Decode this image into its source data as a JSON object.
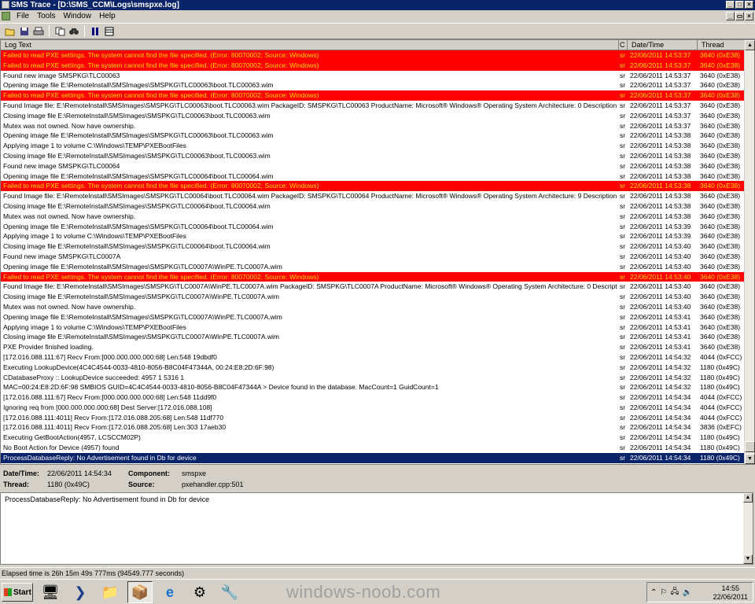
{
  "window": {
    "title": "SMS Trace - [D:\\SMS_CCM\\Logs\\smspxe.log]",
    "min": "_",
    "max": "□",
    "close": "×"
  },
  "menu": [
    "File",
    "Tools",
    "Window",
    "Help"
  ],
  "mdi": {
    "min": "_",
    "restore": "▭",
    "close": "×"
  },
  "columns": {
    "text": "Log Text",
    "c": "C",
    "date": "Date/Time",
    "thread": "Thread"
  },
  "rows": [
    {
      "text": "Failed to read PXE settings. The system cannot find the file specified. (Error: 80070002; Source: Windows)",
      "c": "sr",
      "date": "22/06/2011 14:53:37",
      "thread": "3640 (0xE38)",
      "type": "error"
    },
    {
      "text": "Failed to read PXE settings. The system cannot find the file specified. (Error: 80070002; Source: Windows)",
      "c": "sr",
      "date": "22/06/2011 14:53:37",
      "thread": "3640 (0xE38)",
      "type": "error"
    },
    {
      "text": "Found new image SMSPKG\\TLC00063",
      "c": "sr",
      "date": "22/06/2011 14:53:37",
      "thread": "3640 (0xE38)",
      "type": "normal"
    },
    {
      "text": "Opening image file E:\\RemoteInstall\\SMSImages\\SMSPKG\\TLC00063\\boot.TLC00063.wim",
      "c": "sr",
      "date": "22/06/2011 14:53:37",
      "thread": "3640 (0xE38)",
      "type": "normal"
    },
    {
      "text": "Failed to read PXE settings. The system cannot find the file specified. (Error: 80070002; Source: Windows)",
      "c": "sr",
      "date": "22/06/2011 14:53:37",
      "thread": "3640 (0xE38)",
      "type": "error"
    },
    {
      "text": "Found Image file: E:\\RemoteInstall\\SMSImages\\SMSPKG\\TLC00063\\boot.TLC00063.wim      PackageID: SMSPKG\\TLC00063     ProductName: Microsoft® Windows® Operating System     Architecture: 0     Description",
      "c": "sr",
      "date": "22/06/2011 14:53:37",
      "thread": "3640 (0xE38)",
      "type": "normal"
    },
    {
      "text": "Closing image file E:\\RemoteInstall\\SMSImages\\SMSPKG\\TLC00063\\boot.TLC00063.wim",
      "c": "sr",
      "date": "22/06/2011 14:53:37",
      "thread": "3640 (0xE38)",
      "type": "normal"
    },
    {
      "text": "Mutex was not owned. Now have ownership.",
      "c": "sr",
      "date": "22/06/2011 14:53:37",
      "thread": "3640 (0xE38)",
      "type": "normal"
    },
    {
      "text": "Opening image file E:\\RemoteInstall\\SMSImages\\SMSPKG\\TLC00063\\boot.TLC00063.wim",
      "c": "sr",
      "date": "22/06/2011 14:53:38",
      "thread": "3640 (0xE38)",
      "type": "normal"
    },
    {
      "text": "Applying image 1 to volume C:\\Windows\\TEMP\\PXEBootFiles",
      "c": "sr",
      "date": "22/06/2011 14:53:38",
      "thread": "3640 (0xE38)",
      "type": "normal"
    },
    {
      "text": "Closing image file E:\\RemoteInstall\\SMSImages\\SMSPKG\\TLC00063\\boot.TLC00063.wim",
      "c": "sr",
      "date": "22/06/2011 14:53:38",
      "thread": "3640 (0xE38)",
      "type": "normal"
    },
    {
      "text": "Found new image SMSPKG\\TLC00064",
      "c": "sr",
      "date": "22/06/2011 14:53:38",
      "thread": "3640 (0xE38)",
      "type": "normal"
    },
    {
      "text": "Opening image file E:\\RemoteInstall\\SMSImages\\SMSPKG\\TLC00064\\boot.TLC00064.wim",
      "c": "sr",
      "date": "22/06/2011 14:53:38",
      "thread": "3640 (0xE38)",
      "type": "normal"
    },
    {
      "text": "Failed to read PXE settings. The system cannot find the file specified. (Error: 80070002; Source: Windows)",
      "c": "sr",
      "date": "22/06/2011 14:53:38",
      "thread": "3640 (0xE38)",
      "type": "error"
    },
    {
      "text": "Found Image file: E:\\RemoteInstall\\SMSImages\\SMSPKG\\TLC00064\\boot.TLC00064.wim      PackageID: SMSPKG\\TLC00064     ProductName: Microsoft® Windows® Operating System     Architecture: 9     Description",
      "c": "sr",
      "date": "22/06/2011 14:53:38",
      "thread": "3640 (0xE38)",
      "type": "normal"
    },
    {
      "text": "Closing image file E:\\RemoteInstall\\SMSImages\\SMSPKG\\TLC00064\\boot.TLC00064.wim",
      "c": "sr",
      "date": "22/06/2011 14:53:38",
      "thread": "3640 (0xE38)",
      "type": "normal"
    },
    {
      "text": "Mutex was not owned. Now have ownership.",
      "c": "sr",
      "date": "22/06/2011 14:53:38",
      "thread": "3640 (0xE38)",
      "type": "normal"
    },
    {
      "text": "Opening image file E:\\RemoteInstall\\SMSImages\\SMSPKG\\TLC00064\\boot.TLC00064.wim",
      "c": "sr",
      "date": "22/06/2011 14:53:39",
      "thread": "3640 (0xE38)",
      "type": "normal"
    },
    {
      "text": "Applying image 1 to volume C:\\Windows\\TEMP\\PXEBootFiles",
      "c": "sr",
      "date": "22/06/2011 14:53:39",
      "thread": "3640 (0xE38)",
      "type": "normal"
    },
    {
      "text": "Closing image file E:\\RemoteInstall\\SMSImages\\SMSPKG\\TLC00064\\boot.TLC00064.wim",
      "c": "sr",
      "date": "22/06/2011 14:53:40",
      "thread": "3640 (0xE38)",
      "type": "normal"
    },
    {
      "text": "Found new image SMSPKG\\TLC0007A",
      "c": "sr",
      "date": "22/06/2011 14:53:40",
      "thread": "3640 (0xE38)",
      "type": "normal"
    },
    {
      "text": "Opening image file E:\\RemoteInstall\\SMSImages\\SMSPKG\\TLC0007A\\WinPE.TLC0007A.wim",
      "c": "sr",
      "date": "22/06/2011 14:53:40",
      "thread": "3640 (0xE38)",
      "type": "normal"
    },
    {
      "text": "Failed to read PXE settings. The system cannot find the file specified. (Error: 80070002; Source: Windows)",
      "c": "sr",
      "date": "22/06/2011 14:53:40",
      "thread": "3640 (0xE38)",
      "type": "error"
    },
    {
      "text": "Found Image file: E:\\RemoteInstall\\SMSImages\\SMSPKG\\TLC0007A\\WinPE.TLC0007A.wim      PackageID: SMSPKG\\TLC0007A     ProductName: Microsoft® Windows® Operating System     Architecture: 0     Descript",
      "c": "sr",
      "date": "22/06/2011 14:53:40",
      "thread": "3640 (0xE38)",
      "type": "normal"
    },
    {
      "text": "Closing image file E:\\RemoteInstall\\SMSImages\\SMSPKG\\TLC0007A\\WinPE.TLC0007A.wim",
      "c": "sr",
      "date": "22/06/2011 14:53:40",
      "thread": "3640 (0xE38)",
      "type": "normal"
    },
    {
      "text": "Mutex was not owned. Now have ownership.",
      "c": "sr",
      "date": "22/06/2011 14:53:40",
      "thread": "3640 (0xE38)",
      "type": "normal"
    },
    {
      "text": "Opening image file E:\\RemoteInstall\\SMSImages\\SMSPKG\\TLC0007A\\WinPE.TLC0007A.wim",
      "c": "sr",
      "date": "22/06/2011 14:53:41",
      "thread": "3640 (0xE38)",
      "type": "normal"
    },
    {
      "text": "Applying image 1 to volume C:\\Windows\\TEMP\\PXEBootFiles",
      "c": "sr",
      "date": "22/06/2011 14:53:41",
      "thread": "3640 (0xE38)",
      "type": "normal"
    },
    {
      "text": "Closing image file E:\\RemoteInstall\\SMSImages\\SMSPKG\\TLC0007A\\WinPE.TLC0007A.wim",
      "c": "sr",
      "date": "22/06/2011 14:53:41",
      "thread": "3640 (0xE38)",
      "type": "normal"
    },
    {
      "text": "PXE Provider finished loading.",
      "c": "sr",
      "date": "22/06/2011 14:53:41",
      "thread": "3640 (0xE38)",
      "type": "normal"
    },
    {
      "text": "[172.016.088.111:67] Recv From:[000.000.000.000:68] Len:548 19dbdf0",
      "c": "sr",
      "date": "22/06/2011 14:54:32",
      "thread": "4044 (0xFCC)",
      "type": "normal"
    },
    {
      "text": "Executing LookupDevice(4C4C4544-0033-4810-8056-B8C04F47344A, 00:24:E8:2D:6F:98)",
      "c": "sr",
      "date": "22/06/2011 14:54:32",
      "thread": "1180 (0x49C)",
      "type": "normal"
    },
    {
      "text": "CDatabaseProxy :: LookupDevice succeeded: 4957 1 5316 1",
      "c": "sr",
      "date": "22/06/2011 14:54:32",
      "thread": "1180 (0x49C)",
      "type": "normal"
    },
    {
      "text": "MAC=00:24:E8:2D:6F:98 SMBIOS GUID=4C4C4544-0033-4810-8056-B8C04F47344A > Device found in the database. MacCount=1 GuidCount=1",
      "c": "sr",
      "date": "22/06/2011 14:54:32",
      "thread": "1180 (0x49C)",
      "type": "normal"
    },
    {
      "text": "[172.016.088.111:67] Recv From:[000.000.000.000:68] Len:548 11dd9f0",
      "c": "sr",
      "date": "22/06/2011 14:54:34",
      "thread": "4044 (0xFCC)",
      "type": "normal"
    },
    {
      "text": "Ignoring req from [000.000.000.000:68] Dest Server:[172.016.088.108]",
      "c": "sr",
      "date": "22/06/2011 14:54:34",
      "thread": "4044 (0xFCC)",
      "type": "normal"
    },
    {
      "text": "[172.016.088.111:4011] Recv From:[172.016.088.205:68] Len:548 11df770",
      "c": "sr",
      "date": "22/06/2011 14:54:34",
      "thread": "4044 (0xFCC)",
      "type": "normal"
    },
    {
      "text": "[172.016.088.111:4011] Recv From:[172.016.088.205:68] Len:303 17aeb30",
      "c": "sr",
      "date": "22/06/2011 14:54:34",
      "thread": "3836 (0xEFC)",
      "type": "normal"
    },
    {
      "text": "Executing GetBootAction(4957, LCSCCM02P)",
      "c": "sr",
      "date": "22/06/2011 14:54:34",
      "thread": "1180 (0x49C)",
      "type": "normal"
    },
    {
      "text": "No Boot Action for Device (4957) found",
      "c": "sr",
      "date": "22/06/2011 14:54:34",
      "thread": "1180 (0x49C)",
      "type": "normal"
    },
    {
      "text": "ProcessDatabaseReply: No Advertisement found in Db for device",
      "c": "sr",
      "date": "22/06/2011 14:54:34",
      "thread": "1180 (0x49C)",
      "type": "selected"
    }
  ],
  "details": {
    "datetime_label": "Date/Time:",
    "datetime": "22/06/2011 14:54:34",
    "component_label": "Component:",
    "component": "smspxe",
    "thread_label": "Thread:",
    "thread": "1180 (0x49C)",
    "source_label": "Source:",
    "source": "pxehandler.cpp:501",
    "message": "ProcessDatabaseReply: No Advertisement found in Db for device"
  },
  "status": "Elapsed time is 26h 15m 49s 777ms (94549.777 seconds)",
  "taskbar": {
    "start": "Start",
    "watermark": "windows-noob.com",
    "time": "14:55",
    "date": "22/06/2011"
  }
}
